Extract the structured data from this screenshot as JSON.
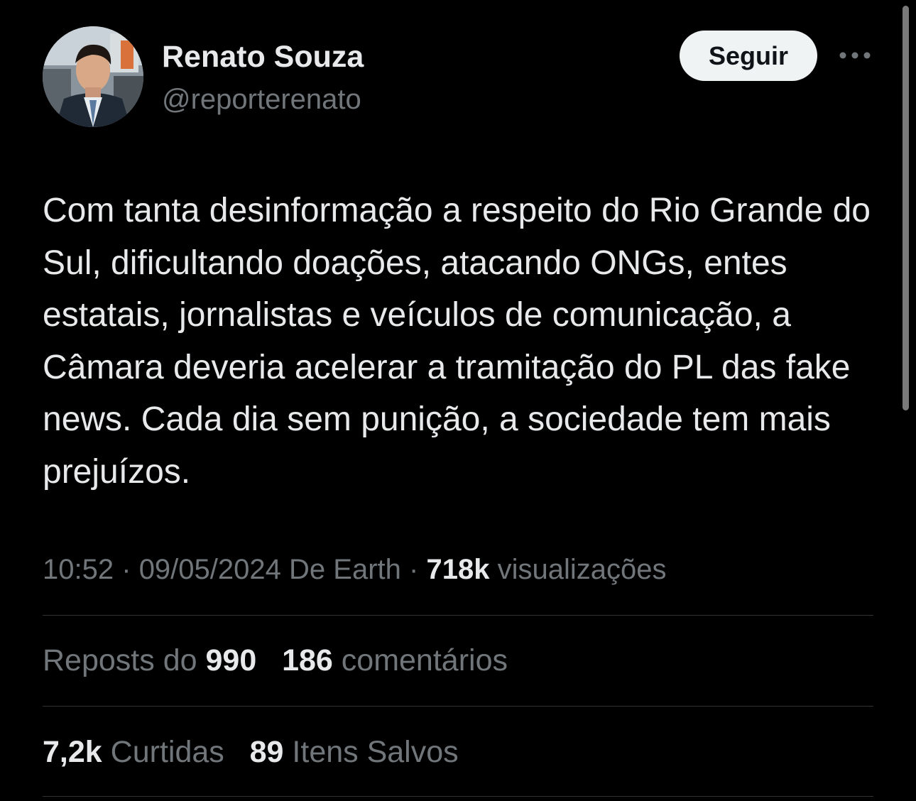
{
  "author": {
    "name": "Renato Souza",
    "handle": "@reporterenato",
    "avatar_icon": "profile-photo"
  },
  "actions": {
    "follow_label": "Seguir",
    "more_icon": "more-horizontal-icon"
  },
  "tweet": {
    "text": "Com tanta desinformação a respeito do Rio Grande do Sul, dificultando doações, atacando ONGs, entes estatais, jornalistas e veículos de comunicação, a Câmara deveria acelerar a tramitação do PL das fake news. Cada dia sem punição, a sociedade tem mais prejuízos.",
    "time": "10:52",
    "separator": "·",
    "date": "09/05/2024",
    "source": "De Earth",
    "views_count": "718k",
    "views_label": "visualizações"
  },
  "stats": {
    "reposts_label": "Reposts do",
    "reposts_count": "990",
    "comments_count": "186",
    "comments_label": "comentários",
    "likes_count": "7,2k",
    "likes_label": "Curtidas",
    "saves_count": "89",
    "saves_label": "Itens Salvos"
  },
  "colors": {
    "background": "#000000",
    "primary_text": "#e7e9ea",
    "secondary_text": "#71767b",
    "divider": "#2f3336",
    "follow_button_bg": "#eff3f4"
  }
}
